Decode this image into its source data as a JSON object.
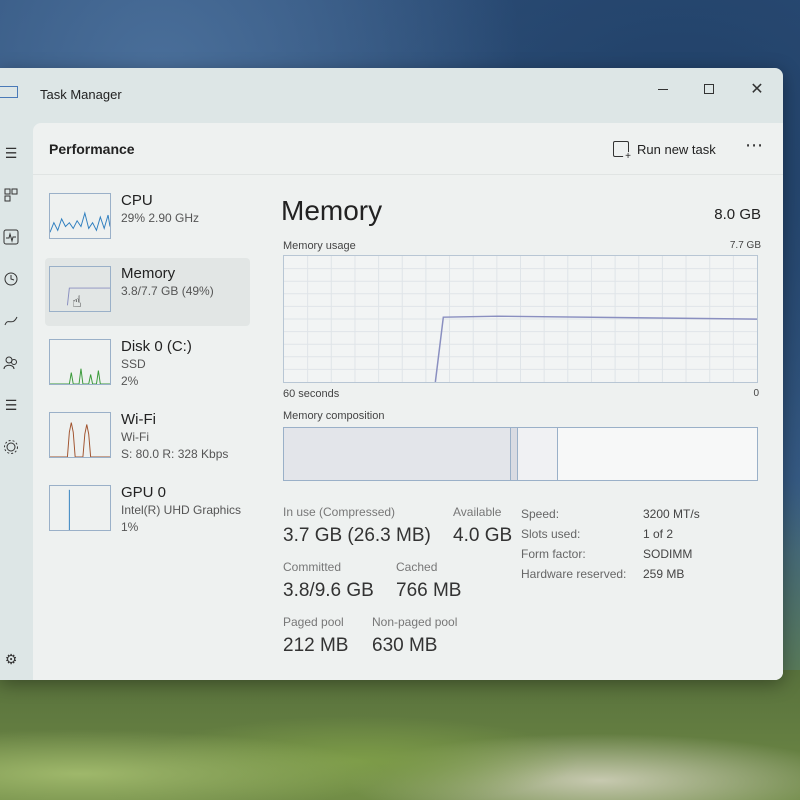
{
  "window": {
    "title": "Task Manager"
  },
  "panel": {
    "title": "Performance",
    "run_new_task": "Run new task",
    "more": "⋯"
  },
  "side_items": [
    {
      "name": "CPU",
      "sub1": "29% 2.90 GHz",
      "sub2": ""
    },
    {
      "name": "Memory",
      "sub1": "3.8/7.7 GB (49%)",
      "sub2": ""
    },
    {
      "name": "Disk 0 (C:)",
      "sub1": "SSD",
      "sub2": "2%"
    },
    {
      "name": "Wi-Fi",
      "sub1": "Wi-Fi",
      "sub2": "S: 80.0 R: 328 Kbps"
    },
    {
      "name": "GPU 0",
      "sub1": "Intel(R) UHD Graphics",
      "sub2": "1%"
    }
  ],
  "main": {
    "title": "Memory",
    "total": "8.0 GB",
    "usage_label": "Memory usage",
    "usage_max": "7.7 GB",
    "axis_left": "60 seconds",
    "axis_right": "0",
    "composition_label": "Memory composition",
    "composition": {
      "in_use_fraction": 0.48,
      "modified_fraction": 0.015,
      "standby_fraction": 0.085,
      "free_fraction": 0.42
    },
    "usage_level_fraction": 0.49
  },
  "stats": {
    "in_use_label": "In use (Compressed)",
    "in_use_value": "3.7 GB (26.3 MB)",
    "available_label": "Available",
    "available_value": "4.0 GB",
    "committed_label": "Committed",
    "committed_value": "3.8/9.6 GB",
    "cached_label": "Cached",
    "cached_value": "766 MB",
    "paged_label": "Paged pool",
    "paged_value": "212 MB",
    "nonpaged_label": "Non-paged pool",
    "nonpaged_value": "630 MB"
  },
  "specs": [
    {
      "key": "Speed:",
      "value": "3200 MT/s"
    },
    {
      "key": "Slots used:",
      "value": "1 of 2"
    },
    {
      "key": "Form factor:",
      "value": "SODIMM"
    },
    {
      "key": "Hardware reserved:",
      "value": "259 MB"
    }
  ],
  "colors": {
    "memory_line": "#8a8fc0",
    "cpu_line": "#2f7fbf",
    "disk_line": "#3a9a3a",
    "wifi_line": "#a0522d",
    "gpu_line": "#2f7fbf"
  }
}
